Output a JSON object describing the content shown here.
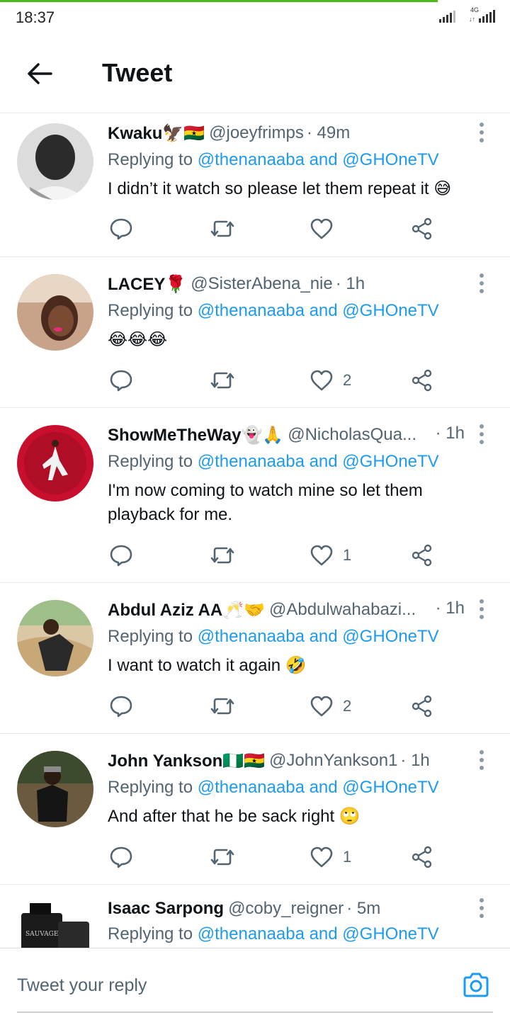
{
  "status": {
    "time": "18:37",
    "network": "4G",
    "network_arrows": "↓↑"
  },
  "header": {
    "title": "Tweet"
  },
  "tweets": [
    {
      "name": "Kwaku🦅🇬🇭",
      "handle": "@joeyfrimps",
      "time": "· 49m",
      "replying_prefix": "Replying to",
      "replying_mentions": "@thenanaaba and @GHOneTV",
      "text": "I didn’t it watch so please let them repeat it 😅",
      "likes": ""
    },
    {
      "name": "LACEY🌹",
      "handle": "@SisterAbena_nie",
      "time": "· 1h",
      "replying_prefix": "Replying to",
      "replying_mentions": "@thenanaaba and @GHOneTV",
      "text": "😂😂😂",
      "likes": "2"
    },
    {
      "name": "ShowMeTheWay👻🙏",
      "handle": "@NicholasQua...",
      "time": "· 1h",
      "replying_prefix": "Replying to",
      "replying_mentions": "@thenanaaba and @GHOneTV",
      "text": "I'm now coming to watch mine so let them playback for me.",
      "likes": "1"
    },
    {
      "name": "Abdul Aziz AA🥂🤝",
      "handle": "@Abdulwahabazi...",
      "time": "· 1h",
      "replying_prefix": "Replying to",
      "replying_mentions": "@thenanaaba and @GHOneTV",
      "text": "I want to watch it again 🤣",
      "likes": "2"
    },
    {
      "name": "John Yankson🇳🇬🇬🇭",
      "handle": "@JohnYankson1",
      "time": "· 1h",
      "replying_prefix": "Replying to",
      "replying_mentions": "@thenanaaba and @GHOneTV",
      "text": "And after that he be sack right 🙄",
      "likes": "1"
    },
    {
      "name": "Isaac Sarpong",
      "handle": "@coby_reigner",
      "time": "· 5m",
      "replying_prefix": "Replying to",
      "replying_mentions": "@thenanaaba and @GHOneTV",
      "text": "",
      "likes": ""
    }
  ],
  "avatar_product_label": "SAUVAGE",
  "reply_bar": {
    "placeholder": "Tweet your reply"
  },
  "colors": {
    "accent": "#1d9bf0",
    "progress": "#4cbb17",
    "secondary_text": "#536471"
  }
}
